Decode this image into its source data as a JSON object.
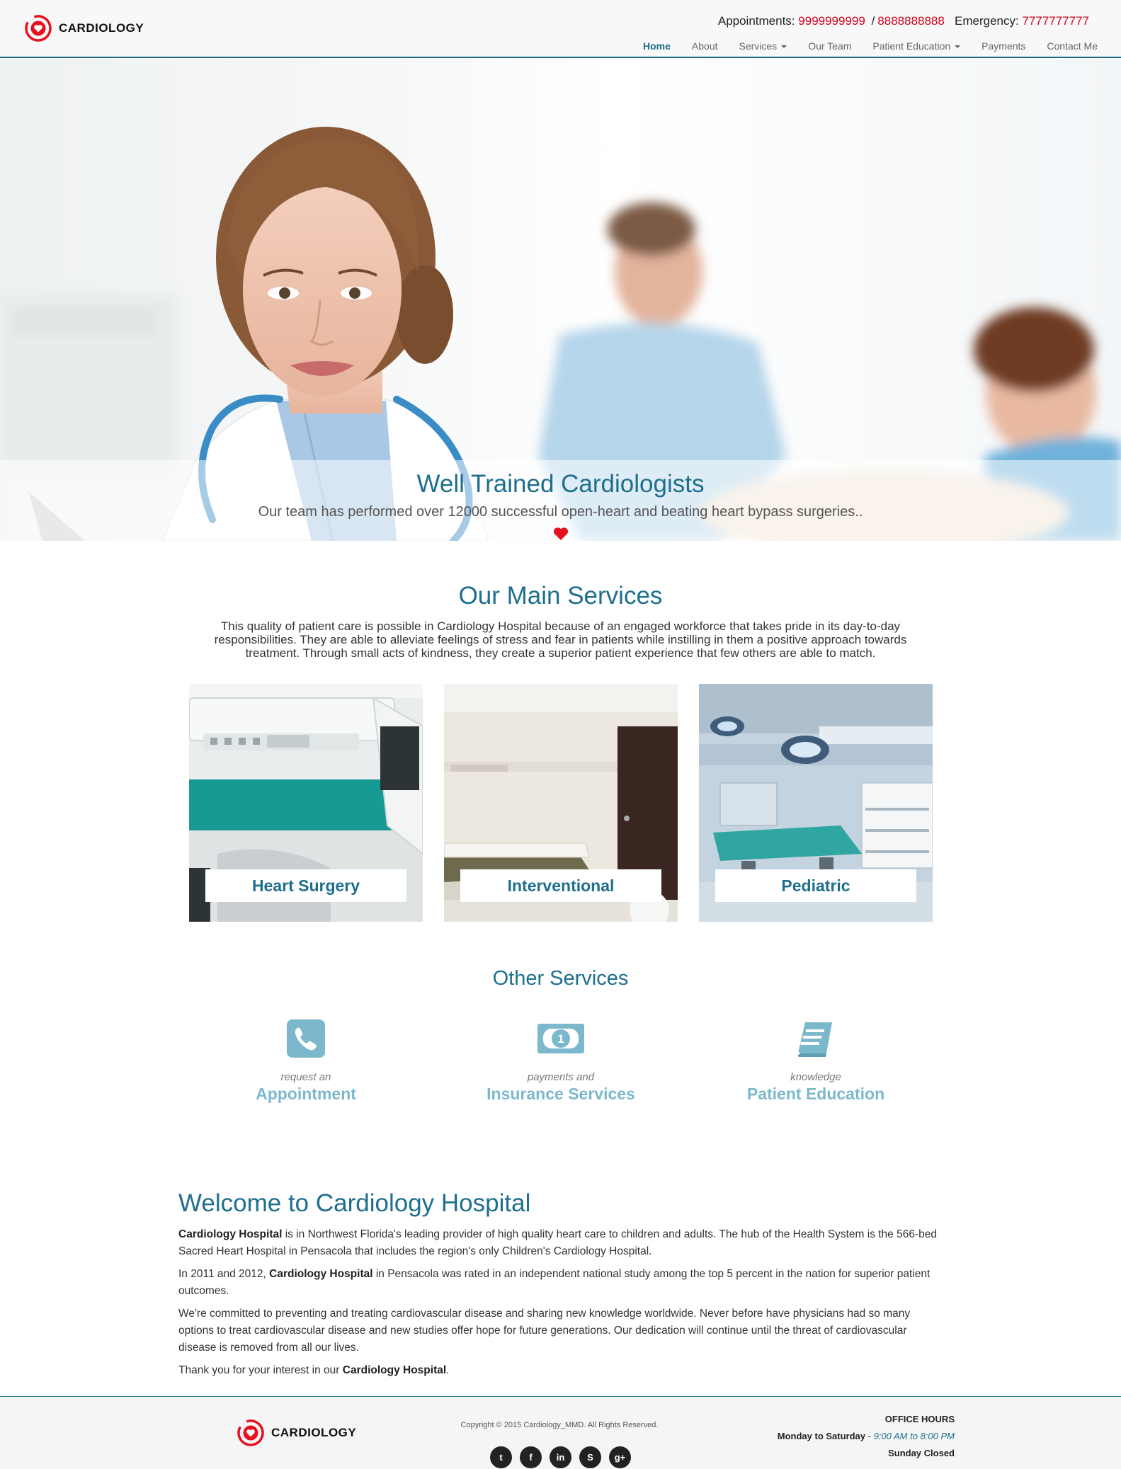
{
  "brand": {
    "name": "CARDIOLOGY"
  },
  "contact": {
    "appointments_label": "Appointments:",
    "appointments_phone_1": "9999999999",
    "separator": "/",
    "appointments_phone_2": "8888888888",
    "emergency_label": "Emergency:",
    "emergency_phone": "7777777777"
  },
  "nav": {
    "items": [
      {
        "label": "Home",
        "active": true
      },
      {
        "label": "About"
      },
      {
        "label": "Services",
        "dropdown": true
      },
      {
        "label": "Our Team"
      },
      {
        "label": "Patient Education",
        "dropdown": true
      },
      {
        "label": "Payments"
      },
      {
        "label": "Contact Me"
      }
    ]
  },
  "hero": {
    "title": "Well Trained Cardiologists",
    "subtitle": "Our team has performed over 12000 successful open-heart and beating heart bypass surgeries.."
  },
  "main_services": {
    "title": "Our Main Services",
    "description": "This quality of patient care is possible in Cardiology Hospital because of an engaged workforce that takes pride in its day-to-day responsibilities. They are able to alleviate feelings of stress and fear in patients while instilling in them a positive approach towards treatment. Through small acts of kindness, they create a superior patient experience that few others are able to match.",
    "cards": [
      {
        "label": "Heart Surgery"
      },
      {
        "label": "Interventional"
      },
      {
        "label": "Pediatric"
      }
    ]
  },
  "other_services": {
    "title": "Other Services",
    "items": [
      {
        "icon": "phone-icon",
        "small": "request an",
        "big": "Appointment"
      },
      {
        "icon": "money-icon",
        "small": "payments and",
        "big": "Insurance Services"
      },
      {
        "icon": "book-icon",
        "small": "knowledge",
        "big": "Patient Education"
      }
    ]
  },
  "welcome": {
    "title": "Welcome to Cardiology Hospital",
    "p1_bold": "Cardiology Hospital",
    "p1_text": " is in Northwest Florida's leading provider of high quality heart care to children and adults. The hub of the Health System is the 566-bed Sacred Heart Hospital in Pensacola that includes the region's only Children's Cardiology Hospital.",
    "p2_pre": "In 2011 and 2012, ",
    "p2_bold": "Cardiology Hospital",
    "p2_text": " in Pensacola was rated in an independent national study among the top 5 percent in the nation for superior patient outcomes.",
    "p3_text": "We're committed to preventing and treating cardiovascular disease and sharing new knowledge worldwide. Never before have physicians had so many options to treat cardiovascular disease and new studies offer hope for future generations. Our dedication will continue until the threat of cardiovascular disease is removed from all our lives.",
    "p4_pre": "Thank you for your interest in our ",
    "p4_bold": "Cardiology Hospital",
    "p4_post": "."
  },
  "footer": {
    "copyright": "Copyright © 2015 Cardiology_MMD. All Rights Reserved.",
    "social": [
      {
        "icon": "twitter-icon",
        "glyph": "t"
      },
      {
        "icon": "facebook-icon",
        "glyph": "f"
      },
      {
        "icon": "linkedin-icon",
        "glyph": "in"
      },
      {
        "icon": "skype-icon",
        "glyph": "S"
      },
      {
        "icon": "google-plus-icon",
        "glyph": "g+"
      }
    ],
    "hours_title": "OFFICE HOURS",
    "hours_days": "Monday to Saturday",
    "hours_dash": " - ",
    "hours_time": "9:00 AM to 8:00 PM",
    "hours_closed": "Sunday Closed"
  },
  "colors": {
    "primary": "#1e6f8e",
    "accent_light": "#7cb8cc",
    "phone_red": "#d0021b",
    "heart_red": "#e8101f"
  }
}
